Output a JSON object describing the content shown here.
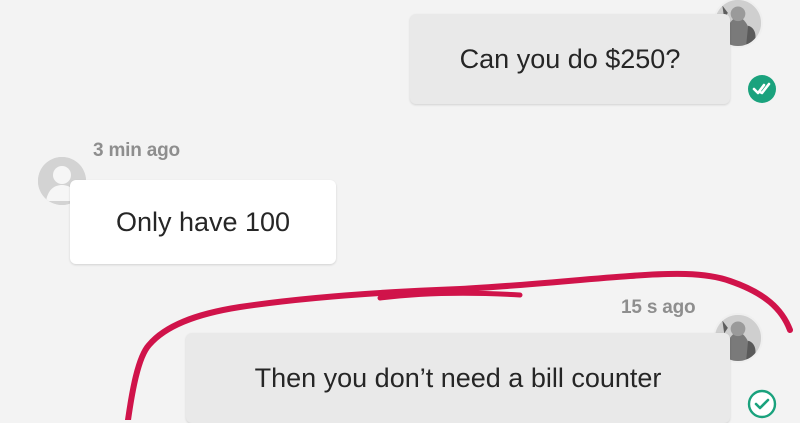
{
  "messages": [
    {
      "direction": "outgoing",
      "text": "Can you do $250?",
      "timestamp": "",
      "status": "read"
    },
    {
      "direction": "incoming",
      "text": "Only have 100",
      "timestamp": "3 min ago"
    },
    {
      "direction": "outgoing",
      "text": "Then you don’t need a bill counter",
      "timestamp": "15 s ago",
      "status": "sent"
    }
  ],
  "colors": {
    "read_check": "#1aa27d",
    "sent_check": "#1aa27d",
    "annotation_scribble": "#d0134a",
    "outgoing_bubble": "#e9e9e9",
    "incoming_bubble": "#ffffff",
    "background": "#f3f3f3"
  },
  "icons": {
    "read_status": "double-check-icon",
    "sent_status": "single-check-icon",
    "incoming_avatar": "person-placeholder-icon",
    "outgoing_avatar": "profile-photo"
  }
}
